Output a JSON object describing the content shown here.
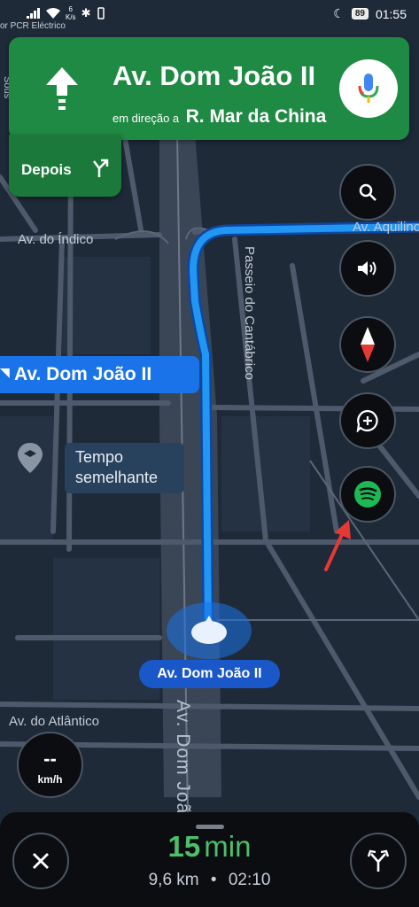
{
  "status_bar": {
    "carrier": "or PCR Eléctrico",
    "net_speed_value": "6",
    "net_speed_unit": "K/s",
    "battery": "89",
    "time": "01:55"
  },
  "navigation": {
    "street": "Av. Dom João II",
    "toward_prefix": "em direção a",
    "toward_street": "R. Mar da China",
    "then_label": "Depois"
  },
  "map": {
    "labels": {
      "indico": "Av. do Índico",
      "aquilino": "Av. Aquilino",
      "cantabrico": "Passeio do Cantábrico",
      "atlantico": "Av. do Atlântico",
      "dom_joao_road": "Av. Dom João",
      "sous": "Sous",
      "left_edge": "Av. Dom João II"
    },
    "time_bubble": [
      "Tempo",
      "semelhante"
    ],
    "current_street": "Av. Dom João II"
  },
  "speed": {
    "value": "--",
    "unit": "km/h"
  },
  "trip": {
    "eta_minutes": "15",
    "eta_unit": "min",
    "distance": "9,6 km",
    "separator": "•",
    "arrival_time": "02:10"
  },
  "colors": {
    "nav_green": "#1f8a43",
    "route_blue": "#1a73e8",
    "eta_green": "#4cbf6a",
    "spotify_green": "#1db954",
    "map_bg": "#1e2a38"
  },
  "icons": {
    "search": "search-icon",
    "sound": "speaker-icon",
    "compass": "compass-icon",
    "report": "add-report-icon",
    "spotify": "spotify-icon",
    "close": "close-icon",
    "routes": "alternate-routes-icon"
  }
}
